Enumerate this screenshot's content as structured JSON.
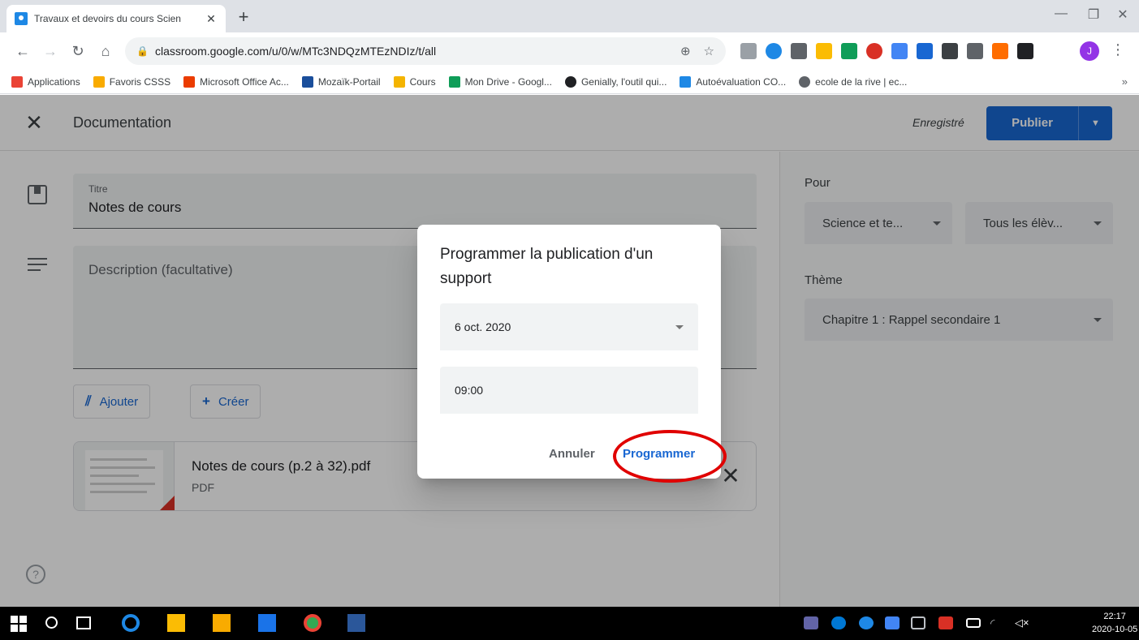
{
  "browser": {
    "tab_title": "Travaux et devoirs du cours Scien",
    "tab_close": "✕",
    "new_tab": "+",
    "url": "classroom.google.com/u/0/w/MTc3NDQzMTEzNDIz/t/all",
    "profile_initial": "J",
    "bookmarks": [
      {
        "label": "Applications",
        "icon_color": "#ea4335"
      },
      {
        "label": "Favoris CSSS",
        "icon_color": "#f9ab00"
      },
      {
        "label": "Microsoft Office Ac...",
        "icon_color": "#eb3c00"
      },
      {
        "label": "Mozaïk-Portail",
        "icon_color": "#1a4e9b"
      },
      {
        "label": "Cours",
        "icon_color": "#f4b400"
      },
      {
        "label": "Mon Drive - Googl...",
        "icon_color": "#0f9d58"
      },
      {
        "label": "Genially, l'outil qui...",
        "icon_color": "#202124"
      },
      {
        "label": "Autoévaluation CO...",
        "icon_color": "#1e88e5"
      },
      {
        "label": "ecole de la rive | ec...",
        "icon_color": "#5f6368"
      }
    ],
    "bookmarks_more": "»"
  },
  "appbar": {
    "title": "Documentation",
    "saved_status": "Enregistré",
    "publish_label": "Publier"
  },
  "form": {
    "title_label": "Titre",
    "title_value": "Notes de cours",
    "description_placeholder": "Description (facultative)",
    "add_label": "Ajouter",
    "create_label": "Créer"
  },
  "attachment": {
    "name": "Notes de cours (p.2 à 32).pdf",
    "type": "PDF"
  },
  "right_panel": {
    "for_label": "Pour",
    "class_value": "Science et te...",
    "students_value": "Tous les élèv...",
    "theme_label": "Thème",
    "theme_value": "Chapitre 1 : Rappel secondaire 1"
  },
  "dialog": {
    "title": "Programmer la publication d'un support",
    "date_value": "6 oct. 2020",
    "time_value": "09:00",
    "cancel_label": "Annuler",
    "schedule_label": "Programmer"
  },
  "taskbar": {
    "time": "22:17",
    "date": "2020-10-05"
  },
  "colors": {
    "primary_blue": "#1967d2",
    "highlight_red": "#e00000"
  }
}
